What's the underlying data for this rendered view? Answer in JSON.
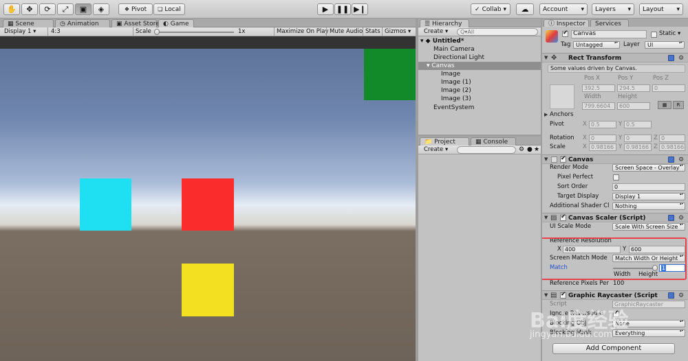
{
  "toolbar": {
    "tools": [
      "hand-tool",
      "move-tool",
      "rotate-tool",
      "scale-tool",
      "rect-tool",
      "transform-tool"
    ],
    "pivot_label": "Pivot",
    "local_label": "Local",
    "collab_label": "Collab ▾",
    "account_label": "Account",
    "layers_label": "Layers",
    "layout_label": "Layout"
  },
  "game_tabs": [
    "Scene",
    "Animation",
    "Asset Store",
    "Game"
  ],
  "game_bar": {
    "display": "Display 1",
    "aspect": "4:3",
    "scale_label": "Scale",
    "scale_value": "1x",
    "maximize": "Maximize On Play",
    "mute": "Mute Audio",
    "stats": "Stats",
    "gizmos": "Gizmos ▾"
  },
  "game_squares": [
    {
      "name": "green-square",
      "color": "#138a2a"
    },
    {
      "name": "cyan-square",
      "color": "#1fe0f2"
    },
    {
      "name": "red-square",
      "color": "#fb2c2c"
    },
    {
      "name": "yellow-square",
      "color": "#f2e021"
    }
  ],
  "hierarchy": {
    "tab": "Hierarchy",
    "create": "Create ▾",
    "search_placeholder": "Q▾All",
    "scene": "Untitled*",
    "items": [
      "Main Camera",
      "Directional Light",
      "Canvas",
      "Image",
      "Image (1)",
      "Image (2)",
      "Image (3)",
      "EventSystem"
    ]
  },
  "project": {
    "tab_project": "Project",
    "tab_console": "Console",
    "create": "Create ▾"
  },
  "inspector": {
    "tab_inspector": "Inspector",
    "tab_services": "Services",
    "object_name": "Canvas",
    "static_label": "Static ▾",
    "tag_label": "Tag",
    "tag_value": "Untagged",
    "layer_label": "Layer",
    "layer_value": "UI",
    "rect_transform": {
      "title": "Rect Transform",
      "note": "Some values driven by Canvas.",
      "pos_x_label": "Pos X",
      "pos_y_label": "Pos Y",
      "pos_z_label": "Pos Z",
      "pos_x": "392.5",
      "pos_y": "294.5",
      "pos_z": "0",
      "width_label": "Width",
      "height_label": "Height",
      "width": "799.6604",
      "height": "600",
      "r_label": "R",
      "anchors_label": "Anchors",
      "pivot_label": "Pivot",
      "pivot_x": "0.5",
      "pivot_y": "0.5",
      "rotation_label": "Rotation",
      "rot_x": "0",
      "rot_y": "0",
      "rot_z": "0",
      "scale_label": "Scale",
      "scale_x": "0.98166",
      "scale_y": "0.98166",
      "scale_z": "0.98166",
      "x": "X",
      "y": "Y",
      "z": "Z"
    },
    "canvas": {
      "title": "Canvas",
      "render_mode_label": "Render Mode",
      "render_mode": "Screen Space - Overlay",
      "pixel_perfect_label": "Pixel Perfect",
      "sort_order_label": "Sort Order",
      "sort_order": "0",
      "target_display_label": "Target Display",
      "target_display": "Display 1",
      "shader_label": "Additional Shader Cl",
      "shader_value": "Nothing"
    },
    "canvas_scaler": {
      "title": "Canvas Scaler (Script)",
      "ui_scale_mode_label": "UI Scale Mode",
      "ui_scale_mode": "Scale With Screen Size",
      "ref_res_label": "Reference Resolution",
      "x_label": "X",
      "ref_x": "400",
      "y_label": "Y",
      "ref_y": "600",
      "match_mode_label": "Screen Match Mode",
      "match_mode": "Match Width Or Height",
      "match_label": "Match",
      "match_value": "1",
      "match_fraction": 1.0,
      "width_label": "Width",
      "height_label": "Height",
      "ref_pixels_label": "Reference Pixels Per",
      "ref_pixels": "100"
    },
    "graphic_raycaster": {
      "title": "Graphic Raycaster (Script",
      "script_label": "Script",
      "script_value": "GraphicRaycaster",
      "ignore_label": "Ignore Reversed G",
      "blocking_obj_label": "Blocking Obj",
      "blocking_obj": "None",
      "blocking_mask_label": "Blocking Mask",
      "blocking_mask": "Everything"
    },
    "add_component": "Add Component"
  },
  "highlight_color": "#e8414a",
  "watermark": {
    "brand": "Bai度经验",
    "url": "jingyan.baidu.com"
  }
}
